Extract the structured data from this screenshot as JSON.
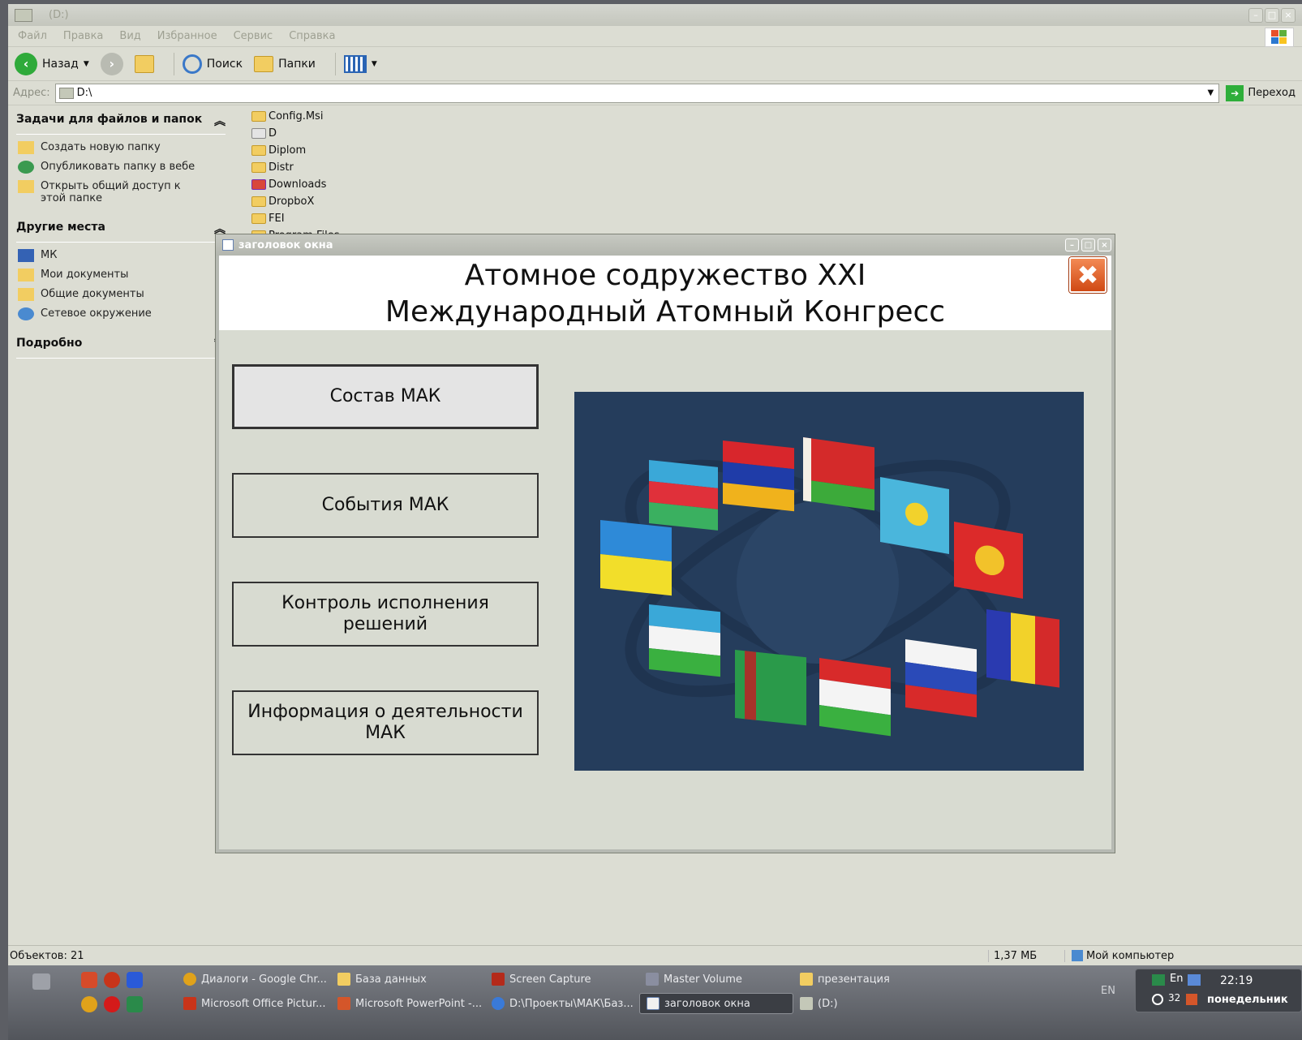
{
  "explorer": {
    "title": "(D:)",
    "menu": [
      "Файл",
      "Правка",
      "Вид",
      "Избранное",
      "Сервис",
      "Справка"
    ],
    "toolbar": {
      "back": "Назад",
      "search": "Поиск",
      "folders": "Папки"
    },
    "address": {
      "label": "Адрес:",
      "value": "D:\\",
      "go": "Переход"
    },
    "tasks": {
      "header": "Задачи для файлов и папок",
      "items": [
        "Создать новую папку",
        "Опубликовать папку в вебе",
        "Открыть общий доступ к этой папке"
      ]
    },
    "places": {
      "header": "Другие места",
      "items": [
        "МК",
        "Мои документы",
        "Общие документы",
        "Сетевое окружение"
      ]
    },
    "details": {
      "header": "Подробно"
    },
    "files": [
      "Config.Msi",
      "D",
      "Diplom",
      "Distr",
      "Downloads",
      "DropboX",
      "FEI",
      "Program Files"
    ],
    "status": {
      "objects": "Объектов: 21",
      "size": "1,37 МБ",
      "location": "Мой компьютер"
    }
  },
  "app": {
    "window_title": "заголовок окна",
    "header_line1": "Атомное содружество XXI",
    "header_line2": "Международный  Атомный  Конгресс",
    "close_glyph": "✖",
    "buttons": [
      "Состав МАК",
      "События МАК",
      "Контроль исполнения решений",
      "Информация о деятельности МАК"
    ]
  },
  "taskbar": {
    "row1": [
      "Диалоги - Google Chr...",
      "База данных",
      "Screen Capture",
      "Master Volume",
      "презентация"
    ],
    "row2": [
      "Microsoft Office Pictur...",
      "Microsoft PowerPoint -...",
      "D:\\Проекты\\МАК\\Баз...",
      "заголовок окна",
      "(D:)"
    ],
    "lang": "EN",
    "tray_lang": "En",
    "tray_num": "32",
    "time": "22:19",
    "day": "понедельник"
  },
  "colors": {
    "flags_bg": "#253d5c",
    "close_orange": "#e0591e"
  }
}
